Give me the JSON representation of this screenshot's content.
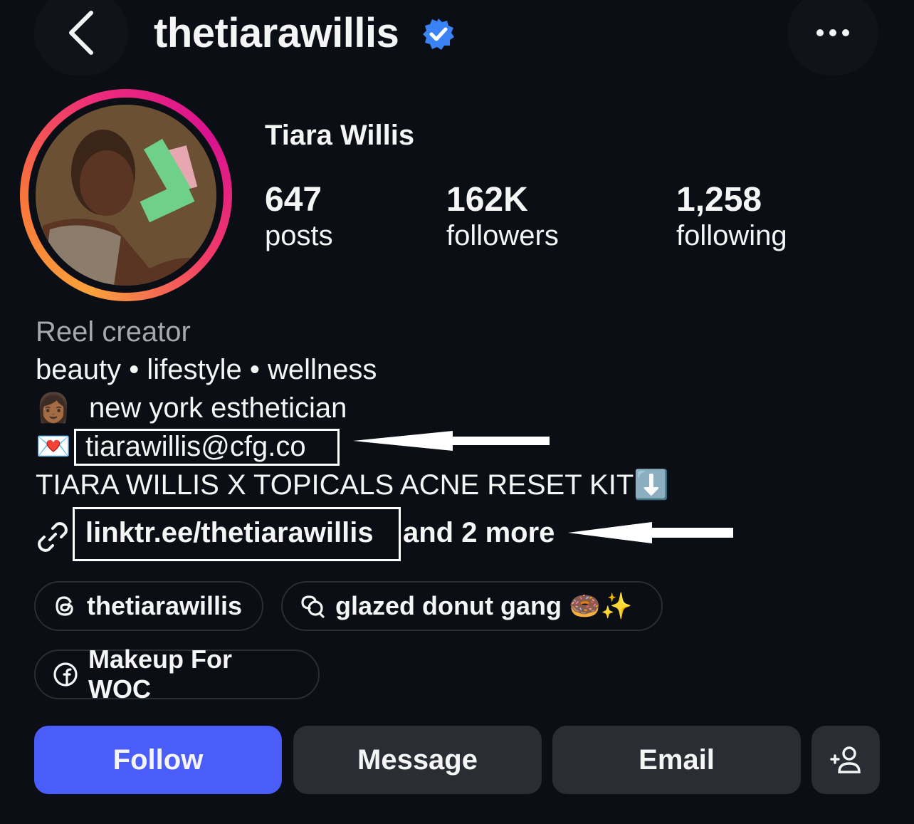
{
  "header": {
    "username": "thetiarawillis"
  },
  "profile": {
    "full_name": "Tiara Willis",
    "stats": [
      {
        "value": "647",
        "label": "posts"
      },
      {
        "value": "162K",
        "label": "followers"
      },
      {
        "value": "1,258",
        "label": "following"
      }
    ]
  },
  "bio": {
    "category": "Reel creator",
    "line1": "beauty • lifestyle • wellness",
    "line2_emoji": "👩🏾",
    "line2_text": "new york esthetician",
    "line3_emoji": "💌",
    "line3_text": "tiarawillis@cfg.co",
    "line4_text": "TIARA WILLIS X TOPICALS ACNE RESET KIT",
    "line4_emoji": "⬇️",
    "link_text": "linktr.ee/thetiarawillis",
    "link_more": "and 2 more"
  },
  "pills": [
    {
      "icon": "threads-icon",
      "label": "thetiarawillis"
    },
    {
      "icon": "channel-icon",
      "label": "glazed donut gang 🍩✨"
    },
    {
      "icon": "facebook-icon",
      "label": "Makeup For WOC"
    }
  ],
  "actions": {
    "follow": "Follow",
    "message": "Message",
    "email": "Email",
    "add_user_icon": "add-person-icon"
  },
  "colors": {
    "background": "#0b0e14",
    "follow_button": "#4a5df9",
    "secondary_button": "#2a2d33",
    "verified_badge": "#3b82f6",
    "muted_text": "#a6a8ad"
  }
}
